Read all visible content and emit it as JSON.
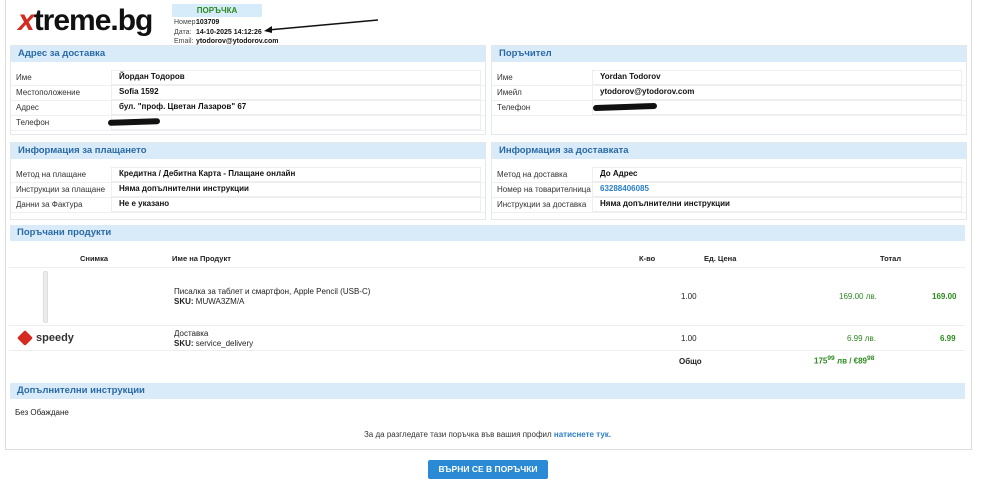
{
  "header": {
    "logo": "xtreme.bg",
    "order_title": "ПОРЪЧКА",
    "number_label": "Номер:",
    "number": "103709",
    "date_label": "Дата:",
    "date": "14-10-2025 14:12:26",
    "email_label": "Email:",
    "email": "ytodorov@ytodorov.com"
  },
  "delivery_address": {
    "title": "Адрес за доставка",
    "rows": [
      {
        "k": "Име",
        "v": "Йордан Тодоров"
      },
      {
        "k": "Местоположение",
        "v": "Sofia 1592"
      },
      {
        "k": "Адрес",
        "v": "бул. \"проф. Цветан Лазаров\" 67"
      },
      {
        "k": "Телефон",
        "v": ""
      }
    ]
  },
  "customer": {
    "title": "Поръчител",
    "rows": [
      {
        "k": "Име",
        "v": "Yordan Todorov"
      },
      {
        "k": "Имейл",
        "v": "ytodorov@ytodorov.com"
      },
      {
        "k": "Телефон",
        "v": ""
      }
    ]
  },
  "payment": {
    "title": "Информация за плащането",
    "rows": [
      {
        "k": "Метод на плащане",
        "v": "Кредитна / Дебитна Карта - Плащане онлайн"
      },
      {
        "k": "Инструкции за плащане",
        "v": "Няма допълнителни инструкции"
      },
      {
        "k": "Данни за Фактура",
        "v": "Не е указано"
      }
    ]
  },
  "shipping": {
    "title": "Информация за доставката",
    "rows": [
      {
        "k": "Метод на доставка",
        "v": "До Адрес"
      },
      {
        "k": "Номер на товарителница",
        "v": "63288406085"
      },
      {
        "k": "Инструкции за доставка",
        "v": "Няма допълнителни инструкции"
      }
    ]
  },
  "products": {
    "title": "Поръчани продукти",
    "columns": {
      "image": "Снимка",
      "name": "Име на Продукт",
      "qty": "К-во",
      "unit": "Ед. Цена",
      "total": "Тотал"
    },
    "items": [
      {
        "name": "Писалка за таблет и смартфон, Apple Pencil (USB-C)",
        "sku_label": "SKU:",
        "sku": "MUWA3ZM/A",
        "qty": "1.00",
        "unit": "169.00 лв.",
        "total": "169.00"
      },
      {
        "name": "Доставка",
        "sku_label": "SKU:",
        "sku": "service_delivery",
        "qty": "1.00",
        "unit": "6.99 лв.",
        "total": "6.99",
        "logo": "speedy"
      }
    ],
    "total_label": "Общо",
    "total_main": "175",
    "total_main_dec": "99",
    "total_mid": " лв / €89",
    "total_eur_dec": "98"
  },
  "extra": {
    "title": "Допълнителни инструкции",
    "text": "Без Обаждане"
  },
  "footer": {
    "note": "За да разгледате тази поръчка във вашия профил",
    "link": "натиснете тук."
  },
  "button": "ВЪРНИ СЕ В ПОРЪЧКИ",
  "colors": {
    "accent": "#2a8ad6",
    "header_bg": "#d9ebf9",
    "green": "#2c8a1f",
    "logo_red": "#d42a1f"
  }
}
